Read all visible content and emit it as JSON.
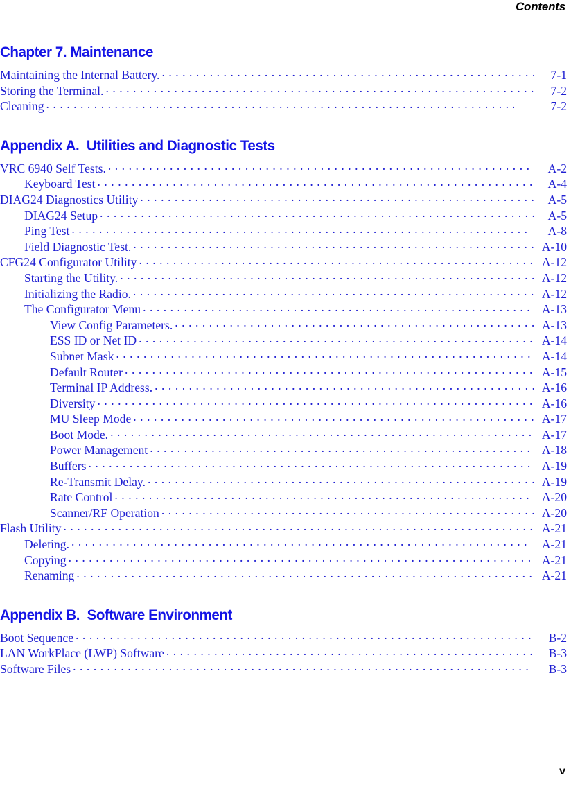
{
  "header": {
    "running_head": "Contents"
  },
  "footer": {
    "folio": "v"
  },
  "colors": {
    "heading_blue": "#1414e6",
    "entry_blue": "#1f1fd2",
    "text_black": "#000000",
    "page_background": "#ffffff"
  },
  "sections": [
    {
      "heading": "Chapter 7. Maintenance",
      "entries": [
        {
          "title": "Maintaining the Internal Battery.",
          "page": "7-1",
          "level": 0
        },
        {
          "title": "Storing the Terminal.",
          "page": "7-2",
          "level": 0
        },
        {
          "title": "Cleaning",
          "page": "7-2",
          "level": 0
        }
      ]
    },
    {
      "heading": "Appendix A.  Utilities and Diagnostic Tests",
      "entries": [
        {
          "title": "VRC 6940 Self Tests.",
          "page": "A-2",
          "level": 0
        },
        {
          "title": "Keyboard Test",
          "page": "A-4",
          "level": 1
        },
        {
          "title": "DIAG24 Diagnostics Utility",
          "page": "A-5",
          "level": 0
        },
        {
          "title": "DIAG24 Setup",
          "page": "A-5",
          "level": 1
        },
        {
          "title": "Ping Test",
          "page": "A-8",
          "level": 1
        },
        {
          "title": "Field Diagnostic Test.",
          "page": "A-10",
          "level": 1
        },
        {
          "title": "CFG24 Configurator Utility",
          "page": "A-12",
          "level": 0
        },
        {
          "title": "Starting the Utility.",
          "page": "A-12",
          "level": 1
        },
        {
          "title": "Initializing the Radio.",
          "page": "A-12",
          "level": 1
        },
        {
          "title": "The Configurator Menu",
          "page": "A-13",
          "level": 1
        },
        {
          "title": "View Config Parameters.",
          "page": "A-13",
          "level": 2
        },
        {
          "title": "ESS ID or Net ID",
          "page": "A-14",
          "level": 2
        },
        {
          "title": "Subnet Mask",
          "page": "A-14",
          "level": 2
        },
        {
          "title": "Default Router",
          "page": "A-15",
          "level": 2
        },
        {
          "title": "Terminal IP Address.",
          "page": "A-16",
          "level": 2
        },
        {
          "title": "Diversity",
          "page": "A-16",
          "level": 2
        },
        {
          "title": "MU Sleep Mode",
          "page": "A-17",
          "level": 2
        },
        {
          "title": "Boot Mode.",
          "page": "A-17",
          "level": 2
        },
        {
          "title": "Power Management",
          "page": "A-18",
          "level": 2
        },
        {
          "title": "Buffers",
          "page": "A-19",
          "level": 2
        },
        {
          "title": "Re-Transmit Delay.",
          "page": "A-19",
          "level": 2
        },
        {
          "title": "Rate Control",
          "page": "A-20",
          "level": 2
        },
        {
          "title": "Scanner/RF Operation",
          "page": "A-20",
          "level": 2
        },
        {
          "title": "Flash Utility",
          "page": "A-21",
          "level": 0
        },
        {
          "title": "Deleting.",
          "page": "A-21",
          "level": 1
        },
        {
          "title": "Copying",
          "page": "A-21",
          "level": 1
        },
        {
          "title": "Renaming",
          "page": "A-21",
          "level": 1
        }
      ]
    },
    {
      "heading": "Appendix B.  Software Environment",
      "entries": [
        {
          "title": "Boot Sequence",
          "page": "B-2",
          "level": 0
        },
        {
          "title": "LAN WorkPlace (LWP) Software",
          "page": "B-3",
          "level": 0
        },
        {
          "title": "Software Files",
          "page": "B-3",
          "level": 0
        }
      ]
    }
  ]
}
